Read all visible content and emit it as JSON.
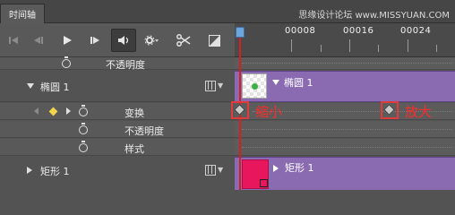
{
  "panel": {
    "tab_label": "时间轴",
    "watermark": "思缘设计论坛 www.MISSYUAN.COM"
  },
  "toolbar": {
    "buttons": [
      {
        "icon": "skip-to-start-icon"
      },
      {
        "icon": "previous-frame-icon"
      },
      {
        "icon": "play-icon"
      },
      {
        "icon": "next-frame-icon"
      },
      {
        "icon": "audio-icon"
      },
      {
        "icon": "settings-icon"
      },
      {
        "icon": "split-icon"
      },
      {
        "icon": "transition-icon"
      }
    ]
  },
  "ruler": {
    "ticks": [
      "00008",
      "00016",
      "00024"
    ]
  },
  "layers": {
    "row0_label": "不透明度",
    "ellipse": {
      "name": "椭圆 1",
      "track_name": "椭圆 1"
    },
    "transform": "变换",
    "opacity": "不透明度",
    "style": "样式",
    "rect": {
      "name": "矩形 1",
      "track_name": "矩形 1"
    }
  },
  "annotations": {
    "shrink": "缩小",
    "enlarge": "放大"
  },
  "colors": {
    "track_purple": "#8a6bb2",
    "annotation_red": "#ff2a2a",
    "playhead": "#d62020",
    "rect_thumb": "#e8175d",
    "ellipse_dot": "#3cb043"
  }
}
